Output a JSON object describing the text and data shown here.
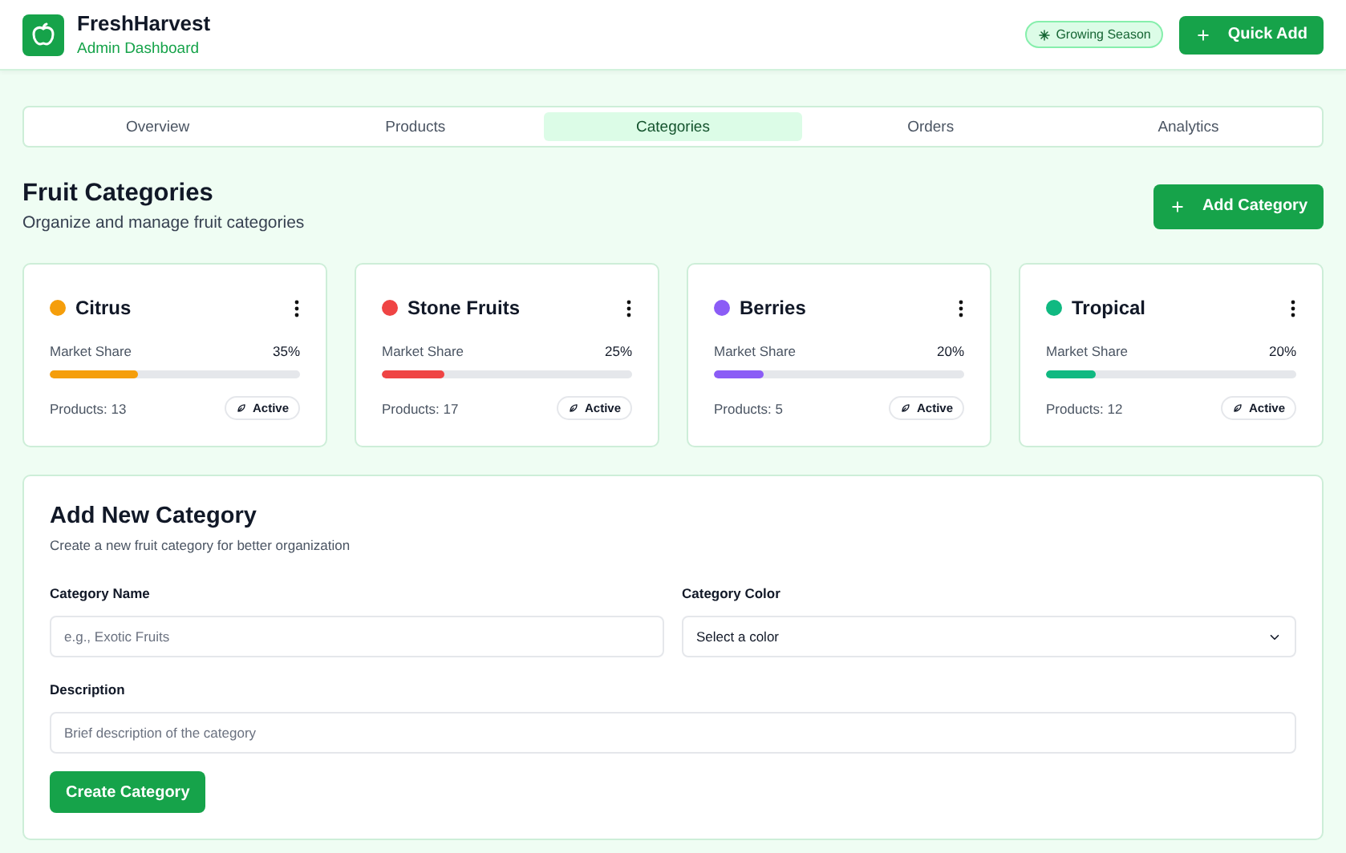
{
  "header": {
    "brand": "FreshHarvest",
    "subtitle": "Admin Dashboard",
    "badge": "Growing Season",
    "quick_add": "Quick Add"
  },
  "tabs": [
    {
      "label": "Overview",
      "selected": false
    },
    {
      "label": "Products",
      "selected": false
    },
    {
      "label": "Categories",
      "selected": true
    },
    {
      "label": "Orders",
      "selected": false
    },
    {
      "label": "Analytics",
      "selected": false
    }
  ],
  "section": {
    "title": "Fruit Categories",
    "subtitle": "Organize and manage fruit categories",
    "add_button": "Add Category"
  },
  "categories": [
    {
      "name": "Citrus",
      "color": "#f59e0b",
      "share_label": "Market Share",
      "share": "35%",
      "level": 0.35,
      "products": "Products: 13",
      "status": "Active"
    },
    {
      "name": "Stone Fruits",
      "color": "#ef4444",
      "share_label": "Market Share",
      "share": "25%",
      "level": 0.25,
      "products": "Products: 17",
      "status": "Active"
    },
    {
      "name": "Berries",
      "color": "#8b5cf6",
      "share_label": "Market Share",
      "share": "20%",
      "level": 0.2,
      "products": "Products: 5",
      "status": "Active"
    },
    {
      "name": "Tropical",
      "color": "#10b981",
      "share_label": "Market Share",
      "share": "20%",
      "level": 0.2,
      "products": "Products: 12",
      "status": "Active"
    }
  ],
  "form": {
    "title": "Add New Category",
    "subtitle": "Create a new fruit category for better organization",
    "name_label": "Category Name",
    "name_placeholder": "e.g., Exotic Fruits",
    "color_label": "Category Color",
    "color_value": "Select a color",
    "description_label": "Description",
    "description_placeholder": "Brief description of the category",
    "submit": "Create Category"
  }
}
